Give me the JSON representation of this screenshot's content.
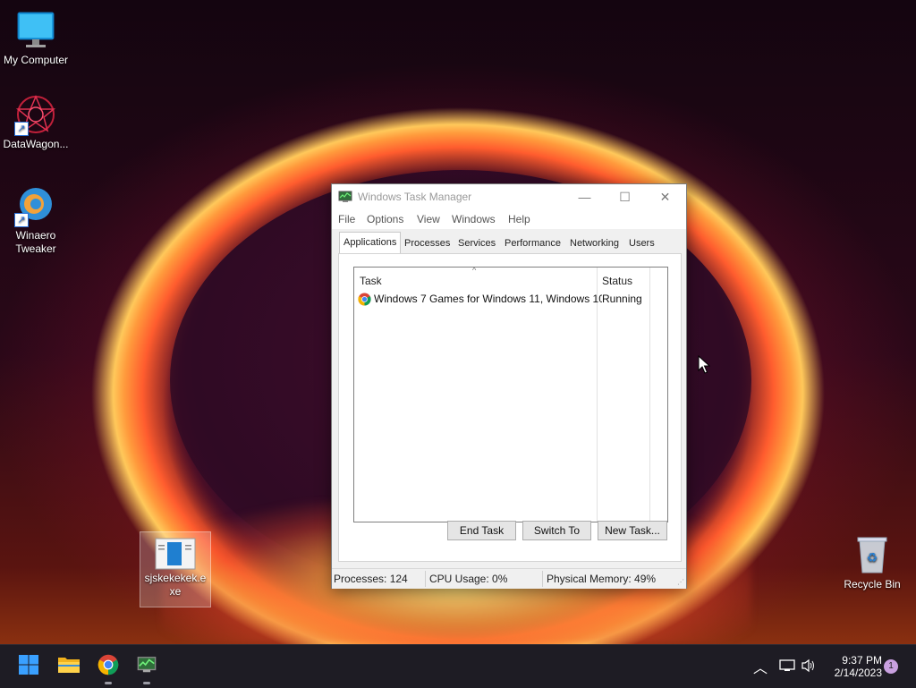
{
  "desktop": {
    "icons": [
      {
        "label": "My Computer",
        "icon": "monitor-icon"
      },
      {
        "label": "DataWagon...",
        "icon": "datawagon-icon"
      },
      {
        "label": "Winaero Tweaker",
        "icon": "winaero-tweaker-icon"
      },
      {
        "label": "sjskekekek.exe",
        "icon": "exe-file-icon"
      },
      {
        "label": "Recycle Bin",
        "icon": "recycle-bin-icon"
      }
    ]
  },
  "task_manager": {
    "title": "Windows Task Manager",
    "menu": [
      "File",
      "Options",
      "View",
      "Windows",
      "Help"
    ],
    "tabs": [
      "Applications",
      "Processes",
      "Services",
      "Performance",
      "Networking",
      "Users"
    ],
    "active_tab": "Applications",
    "columns": {
      "task": "Task",
      "status": "Status"
    },
    "rows": [
      {
        "task": "Windows 7 Games for Windows 11, Windows 10...",
        "status": "Running",
        "icon": "chrome-icon"
      }
    ],
    "buttons": {
      "end_task": "End Task",
      "switch_to": "Switch To",
      "new_task": "New Task..."
    },
    "status": {
      "processes": "Processes: 124",
      "cpu": "CPU Usage: 0%",
      "memory": "Physical Memory: 49%"
    }
  },
  "taskbar": {
    "apps": [
      "start-icon",
      "file-explorer-icon",
      "chrome-icon",
      "task-manager-icon"
    ],
    "clock": {
      "time": "9:37 PM",
      "date": "2/14/2023"
    },
    "notification_count": "1"
  },
  "colors": {
    "accent": "#0078d4",
    "taskbar": "#1e1c24",
    "notification_badge": "#c9a0e0"
  }
}
